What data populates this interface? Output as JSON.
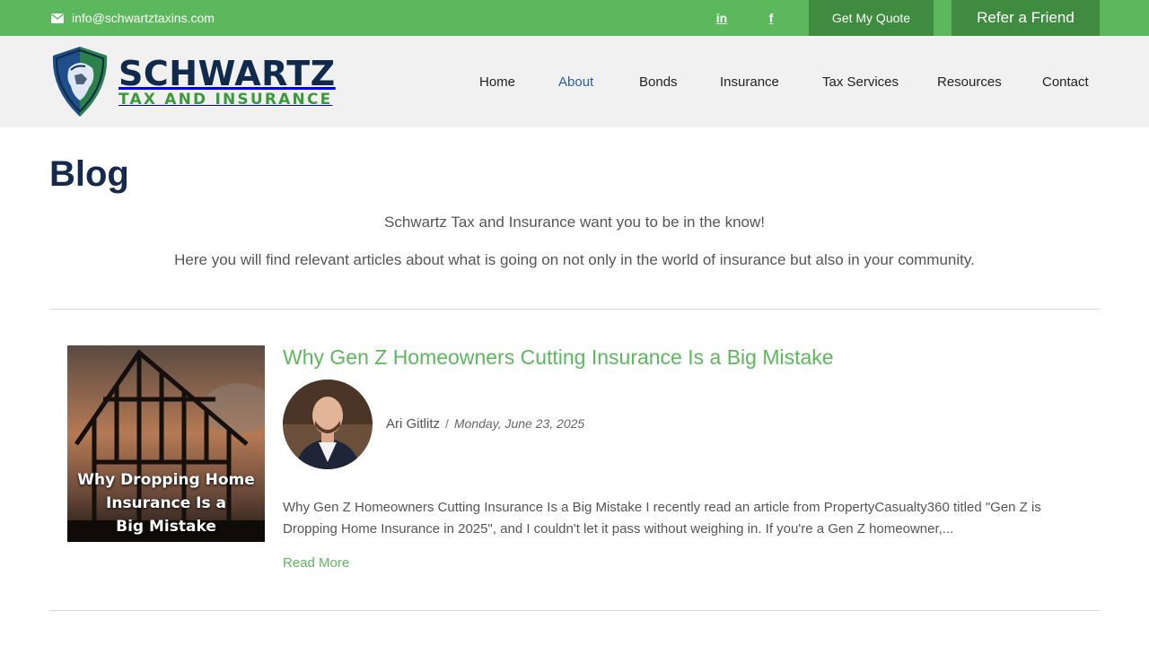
{
  "topbar": {
    "email": "info@schwartztaxins.com",
    "social": [
      {
        "name": "linkedin",
        "label": "in"
      },
      {
        "name": "facebook",
        "label": "f"
      }
    ],
    "quote_button": "Get My Quote",
    "refer_button": "Refer a Friend"
  },
  "header": {
    "logo": {
      "title": "SCHWARTZ",
      "subtitle": "TAX AND INSURANCE"
    },
    "nav": [
      {
        "label": "Home",
        "active": false
      },
      {
        "label": "About",
        "active": true
      },
      {
        "label": "Bonds",
        "active": false
      },
      {
        "label": "Insurance",
        "active": false
      },
      {
        "label": "Tax Services",
        "active": false
      },
      {
        "label": "Resources",
        "active": false
      },
      {
        "label": "Contact",
        "active": false
      }
    ]
  },
  "main": {
    "title": "Blog",
    "intro": [
      "Schwartz Tax and Insurance want you to be in the know!",
      "Here you will find relevant articles about what is going on not only in the world of insurance but also in your community."
    ],
    "posts": [
      {
        "title": "Why Gen Z Homeowners Cutting Insurance Is a Big Mistake",
        "thumb_text": [
          "Why Dropping Home",
          "Insurance Is a",
          "Big Mistake"
        ],
        "author": "Ari Gitlitz",
        "separator": "/",
        "date": "Monday, June 23, 2025",
        "excerpt": "Why Gen Z Homeowners Cutting Insurance Is a Big Mistake I recently read an article from PropertyCasualty360 titled \"Gen Z is Dropping Home Insurance in 2025\", and I couldn't let it pass without weighing in. If you're a Gen Z homeowner,...",
        "read_more": "Read More"
      }
    ]
  },
  "colors": {
    "brand_green": "#5cb85c",
    "dark_green": "#3f8b3f",
    "navy": "#14294b",
    "active_nav": "#2b5f9e"
  }
}
